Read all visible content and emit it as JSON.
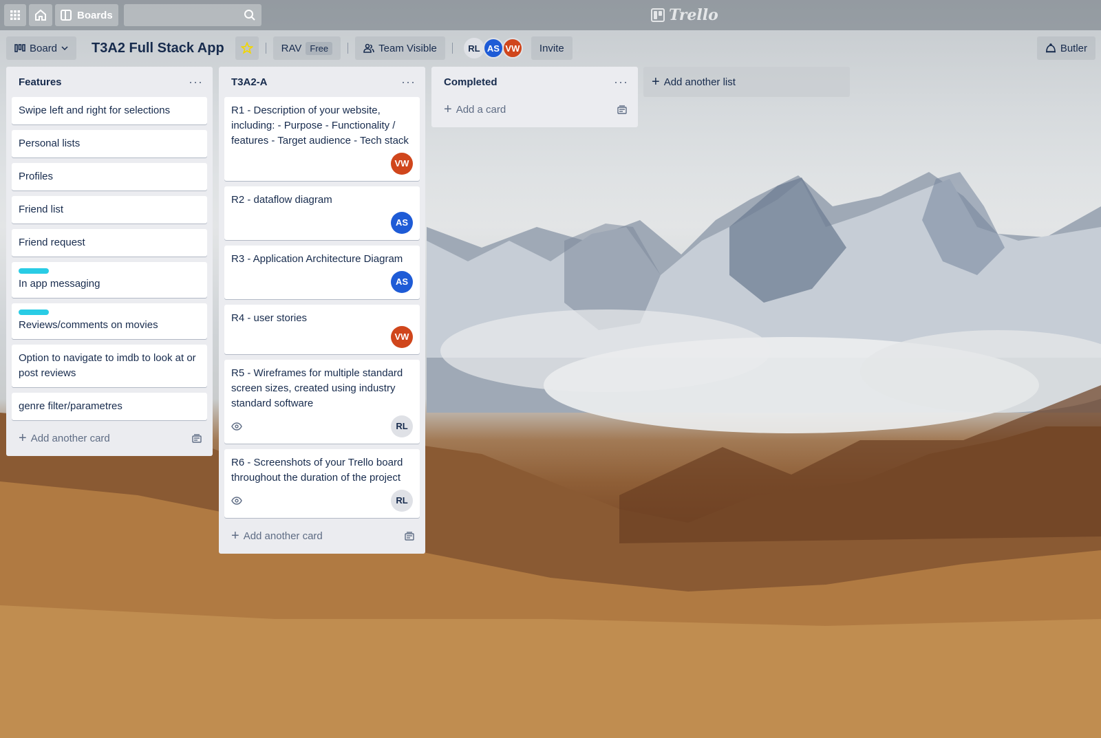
{
  "topbar": {
    "boards_label": "Boards",
    "logo_text": "Trello"
  },
  "board": {
    "view_label": "Board",
    "title": "T3A2 Full Stack App",
    "team_name": "RAV",
    "team_badge": "Free",
    "visibility_label": "Team Visible",
    "members": [
      "RL",
      "AS",
      "VW"
    ],
    "invite_label": "Invite",
    "butler_label": "Butler"
  },
  "lists": [
    {
      "title": "Features",
      "cards": [
        {
          "text": "Swipe left and right for selections"
        },
        {
          "text": "Personal lists"
        },
        {
          "text": "Profiles"
        },
        {
          "text": "Friend list"
        },
        {
          "text": "Friend request"
        },
        {
          "text": "In app messaging",
          "label_color": "#29cce5"
        },
        {
          "text": "Reviews/comments on movies",
          "label_color": "#29cce5"
        },
        {
          "text": "Option to navigate to imdb to look at or post reviews"
        },
        {
          "text": "genre filter/parametres"
        }
      ],
      "add_label": "Add another card"
    },
    {
      "title": "T3A2-A",
      "cards": [
        {
          "text": "R1 - Description of your website, including: - Purpose - Functionality / features - Target audience - Tech stack",
          "member": "VW"
        },
        {
          "text": "R2 - dataflow diagram",
          "member": "AS"
        },
        {
          "text": "R3 - Application Architecture Diagram",
          "member": "AS"
        },
        {
          "text": "R4 - user stories",
          "member": "VW"
        },
        {
          "text": "R5 - Wireframes for multiple standard screen sizes, created using industry standard software",
          "member": "RL",
          "watching": true
        },
        {
          "text": "R6 - Screenshots of your Trello board throughout the duration of the project",
          "member": "RL",
          "watching": true
        }
      ],
      "add_label": "Add another card"
    },
    {
      "title": "Completed",
      "cards": [],
      "add_label": "Add a card"
    }
  ],
  "add_list_label": "Add another list"
}
